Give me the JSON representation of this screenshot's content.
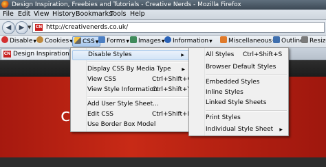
{
  "window": {
    "title": "Design Inspiration, Freebies and Tutorials - Creative Nerds - Mozilla Firefox"
  },
  "menubar": [
    "File",
    "Edit",
    "View",
    "History",
    "Bookmarks",
    "Tools",
    "Help"
  ],
  "nav": {
    "back_icon": "back-arrow-icon",
    "forward_icon": "forward-arrow-icon",
    "url": "http://creativenerds.co.uk/",
    "favicon_text": "CN"
  },
  "toolbar": {
    "items": [
      {
        "label": "Disable",
        "icon": "disable-icon",
        "color": "#d32f2f"
      },
      {
        "label": "Cookies",
        "icon": "cookie-icon",
        "color": "#c08a3e"
      },
      {
        "label": "CSS",
        "icon": "pencil-icon",
        "color": "#e0a000"
      },
      {
        "label": "Forms",
        "icon": "form-icon",
        "color": "#4d7fc2"
      },
      {
        "label": "Images",
        "icon": "image-icon",
        "color": "#3f8a5a"
      },
      {
        "label": "Information",
        "icon": "info-icon",
        "color": "#2b63b8"
      },
      {
        "label": "Miscellaneous",
        "icon": "misc-icon",
        "color": "#e07a2a"
      },
      {
        "label": "Outline",
        "icon": "outline-icon",
        "color": "#3f6fae"
      },
      {
        "label": "Resize",
        "icon": "resize-icon",
        "color": "#7a7a7a"
      }
    ]
  },
  "tab": {
    "title": "Design Inspiration, Free"
  },
  "page": {
    "banner_text": "cre",
    "banner_sub": ""
  },
  "css_menu": {
    "items": [
      {
        "label": "Disable Styles",
        "shortcut": "",
        "submenu": true
      },
      {
        "label": "Display CSS By Media Type",
        "shortcut": "",
        "submenu": true
      },
      {
        "label": "View CSS",
        "shortcut": "Ctrl+Shift+C",
        "submenu": false
      },
      {
        "label": "View Style Information",
        "shortcut": "Ctrl+Shift+Y",
        "submenu": false
      },
      {
        "label": "Add User Style Sheet...",
        "shortcut": "",
        "submenu": false
      },
      {
        "label": "Edit CSS",
        "shortcut": "Ctrl+Shift+E",
        "submenu": false
      },
      {
        "label": "Use Border Box Model",
        "shortcut": "",
        "submenu": false
      }
    ]
  },
  "disable_styles_menu": {
    "items": [
      {
        "label": "All Styles",
        "shortcut": "Ctrl+Shift+S",
        "submenu": false
      },
      {
        "label": "Browser Default Styles",
        "shortcut": "",
        "submenu": false
      },
      {
        "label": "Embedded Styles",
        "shortcut": "",
        "submenu": false
      },
      {
        "label": "Inline Styles",
        "shortcut": "",
        "submenu": false
      },
      {
        "label": "Linked Style Sheets",
        "shortcut": "",
        "submenu": false
      },
      {
        "label": "Print Styles",
        "shortcut": "",
        "submenu": false
      },
      {
        "label": "Individual Style Sheet",
        "shortcut": "",
        "submenu": true
      }
    ]
  }
}
